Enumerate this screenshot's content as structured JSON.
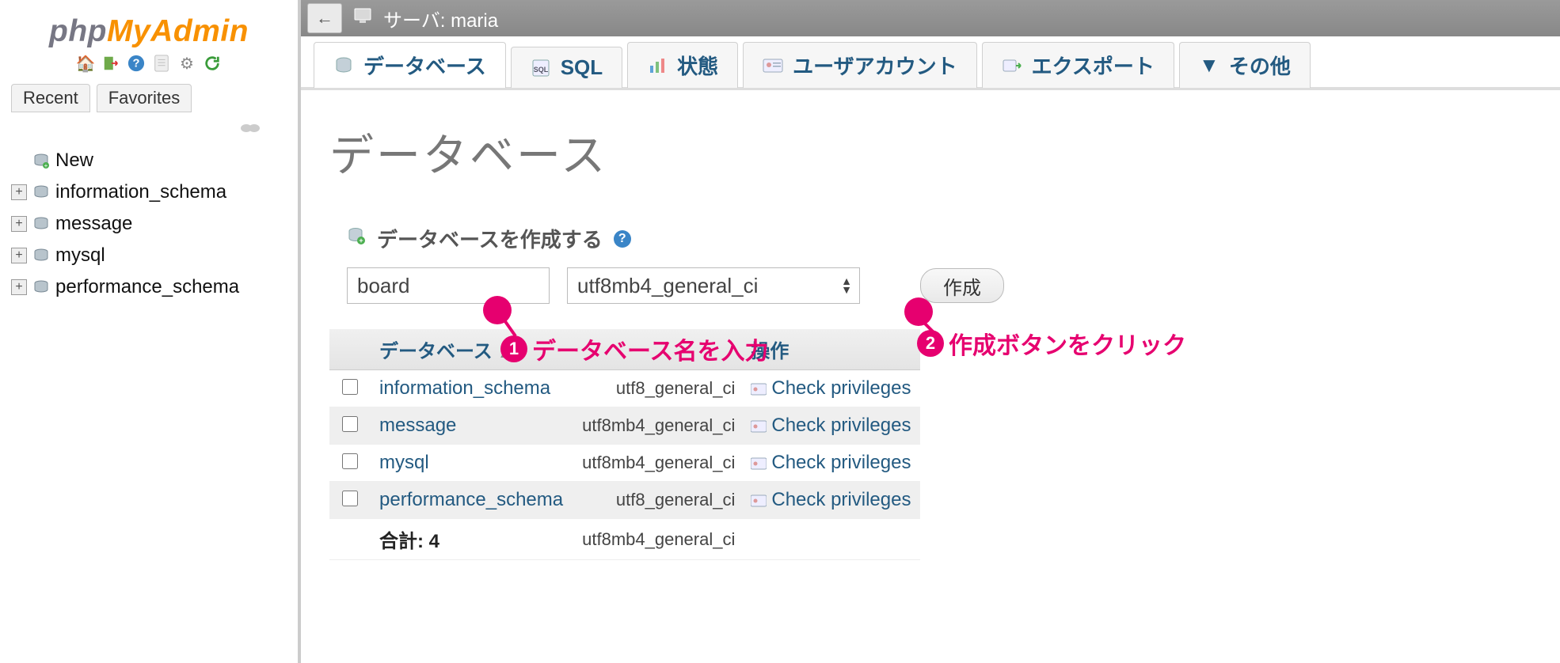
{
  "brand": {
    "part1": "php",
    "part2": "MyAdmin"
  },
  "sidebar_tabs": {
    "recent": "Recent",
    "favorites": "Favorites"
  },
  "tree": {
    "new_label": "New",
    "items": [
      {
        "name": "information_schema"
      },
      {
        "name": "message"
      },
      {
        "name": "mysql"
      },
      {
        "name": "performance_schema"
      }
    ]
  },
  "serverbar": {
    "label": "サーバ: maria"
  },
  "main_tabs": [
    {
      "label": "データベース",
      "active": true,
      "icon": "db"
    },
    {
      "label": "SQL",
      "icon": "sql"
    },
    {
      "label": "状態",
      "icon": "status"
    },
    {
      "label": "ユーザアカウント",
      "icon": "users"
    },
    {
      "label": "エクスポート",
      "icon": "export"
    },
    {
      "label": "その他",
      "icon": "more"
    }
  ],
  "page": {
    "heading": "データベース",
    "create_label": "データベースを作成する",
    "dbname_value": "board",
    "collation_value": "utf8mb4_general_ci",
    "create_button": "作成"
  },
  "table": {
    "col_db": "データベース",
    "col_action": "操作",
    "check_privileges": "Check privileges",
    "rows": [
      {
        "name": "information_schema",
        "coll": "utf8_general_ci"
      },
      {
        "name": "message",
        "coll": "utf8mb4_general_ci"
      },
      {
        "name": "mysql",
        "coll": "utf8mb4_general_ci"
      },
      {
        "name": "performance_schema",
        "coll": "utf8_general_ci"
      }
    ],
    "total_label": "合計: 4",
    "total_coll": "utf8mb4_general_ci"
  },
  "annotations": {
    "a1": "データベース名を入力",
    "a2": "作成ボタンをクリック"
  }
}
